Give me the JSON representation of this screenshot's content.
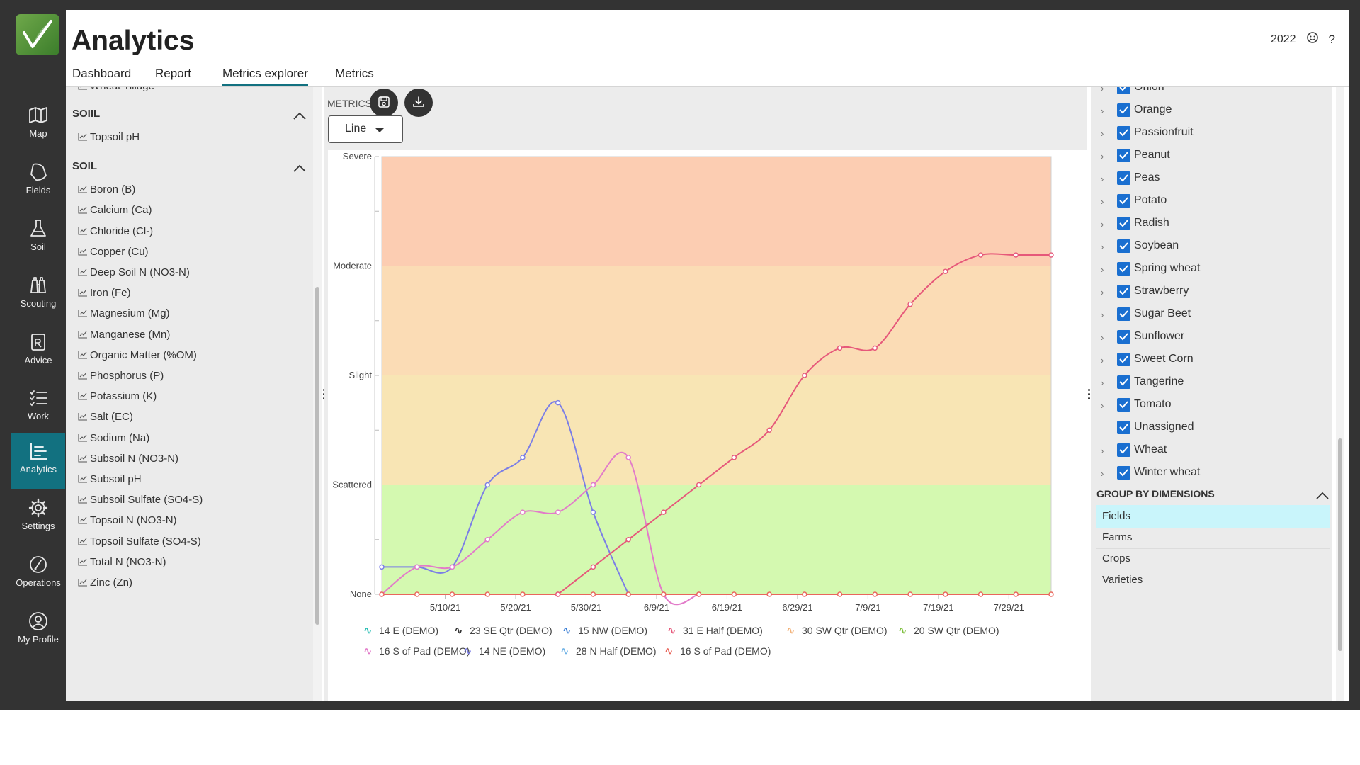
{
  "app": {
    "title": "Analytics",
    "year": "2022",
    "tabs": [
      {
        "label": "Dashboard"
      },
      {
        "label": "Report"
      },
      {
        "label": "Metrics explorer"
      },
      {
        "label": "Metrics"
      }
    ]
  },
  "nav": [
    {
      "label": "Map",
      "icon": "map-icon"
    },
    {
      "label": "Fields",
      "icon": "fields-icon"
    },
    {
      "label": "Soil",
      "icon": "flask-icon"
    },
    {
      "label": "Scouting",
      "icon": "binoculars-icon"
    },
    {
      "label": "Advice",
      "icon": "prescription-icon"
    },
    {
      "label": "Work",
      "icon": "checklist-icon"
    },
    {
      "label": "Analytics",
      "icon": "analytics-icon"
    },
    {
      "label": "Settings",
      "icon": "gear-icon"
    },
    {
      "label": "Operations",
      "icon": "gauge-icon"
    },
    {
      "label": "My Profile",
      "icon": "user-icon"
    }
  ],
  "left_panel": {
    "partial_item": "Wheat Tillage",
    "sections": [
      {
        "title": "SOIIL",
        "items": [
          "Topsoil pH"
        ]
      },
      {
        "title": "SOIL",
        "items": [
          "Boron (B)",
          "Calcium (Ca)",
          "Chloride (Cl-)",
          "Copper (Cu)",
          "Deep Soil N (NO3-N)",
          "Iron (Fe)",
          "Magnesium (Mg)",
          "Manganese (Mn)",
          "Organic Matter (%OM)",
          "Phosphorus (P)",
          "Potassium (K)",
          "Salt (EC)",
          "Sodium (Na)",
          "Subsoil N (NO3-N)",
          "Subsoil pH",
          "Subsoil Sulfate (SO4-S)",
          "Topsoil N (NO3-N)",
          "Topsoil Sulfate (SO4-S)",
          "Total N (NO3-N)",
          "Zinc (Zn)"
        ]
      }
    ]
  },
  "toolbar": {
    "metrics_label": "METRICS",
    "chart_type": "Line",
    "save_icon": "save-icon",
    "download_icon": "download-icon"
  },
  "chart_data": {
    "type": "line",
    "title": "",
    "y_categories": [
      "None",
      "Scattered",
      "Slight",
      "Moderate",
      "Severe"
    ],
    "ylim": [
      0,
      4
    ],
    "x_tick_labels": [
      "5/10/21",
      "5/20/21",
      "5/30/21",
      "6/9/21",
      "6/19/21",
      "6/29/21",
      "7/9/21",
      "7/19/21",
      "7/29/21"
    ],
    "x_dates": [
      "5/1/21",
      "5/6/21",
      "5/11/21",
      "5/16/21",
      "5/21/21",
      "5/26/21",
      "5/31/21",
      "6/5/21",
      "6/10/21",
      "6/15/21",
      "6/20/21",
      "6/25/21",
      "6/30/21",
      "7/5/21",
      "7/10/21",
      "7/15/21",
      "7/20/21",
      "7/25/21",
      "7/30/21",
      "8/4/21"
    ],
    "bands": [
      {
        "from": 0,
        "to": 1,
        "color": "#d4f9b0"
      },
      {
        "from": 1,
        "to": 2,
        "color": "#f8e5b4"
      },
      {
        "from": 2,
        "to": 3,
        "color": "#fbdcb5"
      },
      {
        "from": 3,
        "to": 4,
        "color": "#fccdb2"
      }
    ],
    "series": [
      {
        "name": "14 NE (DEMO)",
        "color": "#7b7ee6",
        "values": [
          0.25,
          0.25,
          0.25,
          1.0,
          1.25,
          1.75,
          0.75,
          0,
          null,
          null,
          null,
          null,
          null,
          null,
          null,
          null,
          null,
          null,
          null,
          null
        ]
      },
      {
        "name": "16 S of Pad (DEMO)",
        "color": "#e27bc9",
        "values": [
          0,
          0.25,
          0.25,
          0.5,
          0.75,
          0.75,
          1.0,
          1.25,
          0,
          0,
          null,
          null,
          null,
          null,
          null,
          null,
          null,
          null,
          null,
          null
        ]
      },
      {
        "name": "16 S of Pad (DEMO)",
        "color": "#e9665c",
        "values": [
          0,
          0,
          0,
          0,
          0,
          0,
          0,
          0,
          0,
          0,
          0,
          0,
          0,
          0,
          0,
          0,
          0,
          0,
          0,
          0
        ]
      },
      {
        "name": "31 E Half (DEMO)",
        "color": "#e6587a",
        "values": [
          null,
          null,
          null,
          null,
          null,
          0,
          0.25,
          0.5,
          0.75,
          1.0,
          1.25,
          1.5,
          2.0,
          2.25,
          2.25,
          2.65,
          2.95,
          3.1,
          3.1,
          3.1
        ]
      }
    ],
    "legend": [
      {
        "name": "14 E (DEMO)",
        "color": "#2bbfb5"
      },
      {
        "name": "23 SE Qtr (DEMO)",
        "color": "#333333"
      },
      {
        "name": "15 NW (DEMO)",
        "color": "#3b7fd6"
      },
      {
        "name": "31 E Half (DEMO)",
        "color": "#e6587a"
      },
      {
        "name": "30 SW Qtr (DEMO)",
        "color": "#f2b27a"
      },
      {
        "name": "20 SW Qtr (DEMO)",
        "color": "#7fbf3f"
      },
      {
        "name": "16 S of Pad (DEMO)",
        "color": "#e27bc9"
      },
      {
        "name": "14 NE (DEMO)",
        "color": "#7b7ee6"
      },
      {
        "name": "28 N Half (DEMO)",
        "color": "#6fb2e6"
      },
      {
        "name": "16 S of Pad (DEMO)",
        "color": "#e9665c"
      }
    ],
    "legend_position": "bottom",
    "grid": false
  },
  "right_panel": {
    "crops": [
      {
        "name": "Onion",
        "checked": true,
        "expandable": true
      },
      {
        "name": "Orange",
        "checked": true,
        "expandable": true
      },
      {
        "name": "Passionfruit",
        "checked": true,
        "expandable": true
      },
      {
        "name": "Peanut",
        "checked": true,
        "expandable": true
      },
      {
        "name": "Peas",
        "checked": true,
        "expandable": true
      },
      {
        "name": "Potato",
        "checked": true,
        "expandable": true
      },
      {
        "name": "Radish",
        "checked": true,
        "expandable": true
      },
      {
        "name": "Soybean",
        "checked": true,
        "expandable": true
      },
      {
        "name": "Spring wheat",
        "checked": true,
        "expandable": true
      },
      {
        "name": "Strawberry",
        "checked": true,
        "expandable": true
      },
      {
        "name": "Sugar Beet",
        "checked": true,
        "expandable": true
      },
      {
        "name": "Sunflower",
        "checked": true,
        "expandable": true
      },
      {
        "name": "Sweet Corn",
        "checked": true,
        "expandable": true
      },
      {
        "name": "Tangerine",
        "checked": true,
        "expandable": true
      },
      {
        "name": "Tomato",
        "checked": true,
        "expandable": true
      },
      {
        "name": "Unassigned",
        "checked": true,
        "expandable": false
      },
      {
        "name": "Wheat",
        "checked": true,
        "expandable": true
      },
      {
        "name": "Winter wheat",
        "checked": true,
        "expandable": true
      }
    ],
    "group_by": {
      "title": "GROUP BY DIMENSIONS",
      "items": [
        "Fields",
        "Farms",
        "Crops",
        "Varieties"
      ],
      "selected": "Fields"
    }
  }
}
